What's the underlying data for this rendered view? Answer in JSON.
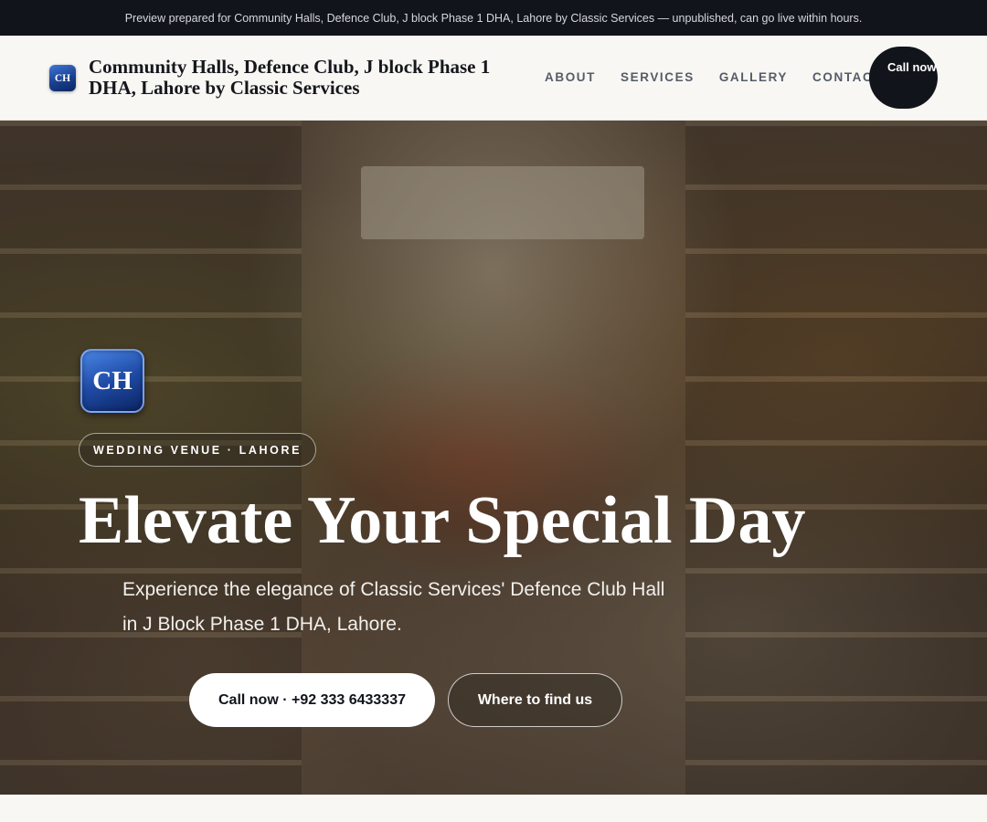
{
  "banner": {
    "text": "Preview prepared for Community Halls, Defence Club, J block Phase 1 DHA, Lahore by Classic Services — unpublished, can go live within hours."
  },
  "header": {
    "logo_initials": "CH",
    "brand_name": "Community Halls, Defence Club, J block Phase 1 DHA, Lahore by Classic Services",
    "nav": [
      "ABOUT",
      "SERVICES",
      "GALLERY",
      "CONTACT"
    ],
    "call_label": "Call now"
  },
  "hero": {
    "badge_initials": "CH",
    "eyebrow": "WEDDING VENUE · LAHORE",
    "headline": "Elevate Your Special Day",
    "subhead": "Experience the elegance of Classic Services' Defence Club Hall in J Block Phase 1 DHA, Lahore.",
    "primary_button": "Call now · +92 333 6433337",
    "secondary_button": "Where to find us",
    "background_image": "market-shop-interior"
  },
  "colors": {
    "dark": "#11141b",
    "accent_blue": "#1f4ba6",
    "page_bg": "#f8f7f3"
  }
}
